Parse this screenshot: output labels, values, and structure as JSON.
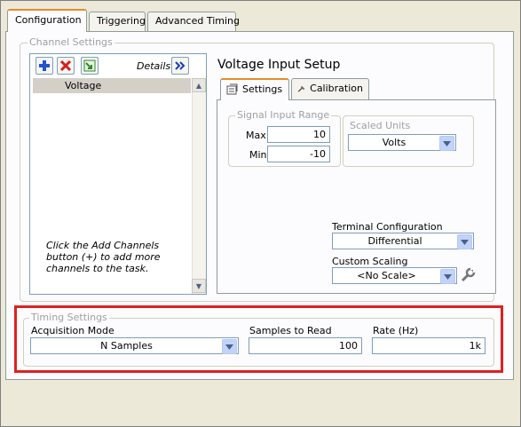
{
  "main_tabs": [
    {
      "label": "Configuration"
    },
    {
      "label": "Triggering"
    },
    {
      "label": "Advanced Timing"
    }
  ],
  "channel_settings": {
    "legend": "Channel Settings",
    "details_label": "Details",
    "channels": [
      "Voltage"
    ],
    "hint": "Click the Add Channels button (+) to add more channels to the task."
  },
  "voltage_setup": {
    "title": "Voltage Input Setup",
    "tabs": [
      {
        "label": "Settings"
      },
      {
        "label": "Calibration"
      }
    ],
    "signal_range": {
      "legend": "Signal Input Range",
      "max_label": "Max",
      "max": "10",
      "min_label": "Min",
      "min": "-10"
    },
    "scaled_units": {
      "legend": "Scaled Units",
      "value": "Volts"
    },
    "terminal_config": {
      "label": "Terminal Configuration",
      "value": "Differential"
    },
    "custom_scaling": {
      "label": "Custom Scaling",
      "value": "<No Scale>"
    }
  },
  "timing": {
    "legend": "Timing Settings",
    "mode_label": "Acquisition Mode",
    "mode": "N Samples",
    "samples_label": "Samples to Read",
    "samples": "100",
    "rate_label": "Rate (Hz)",
    "rate": "1k"
  },
  "colors": {
    "highlight": "#e02020",
    "tab_accent": "#e68b2c",
    "panel_bg": "#fcfcfe",
    "window_bg": "#ece9d8"
  },
  "icons": [
    "add-channel-icon",
    "remove-channel-icon",
    "browse-channel-icon",
    "expand-details-icon",
    "settings-icon",
    "calibration-icon",
    "dropdown-arrow-icon",
    "scale-wrench-icon"
  ]
}
